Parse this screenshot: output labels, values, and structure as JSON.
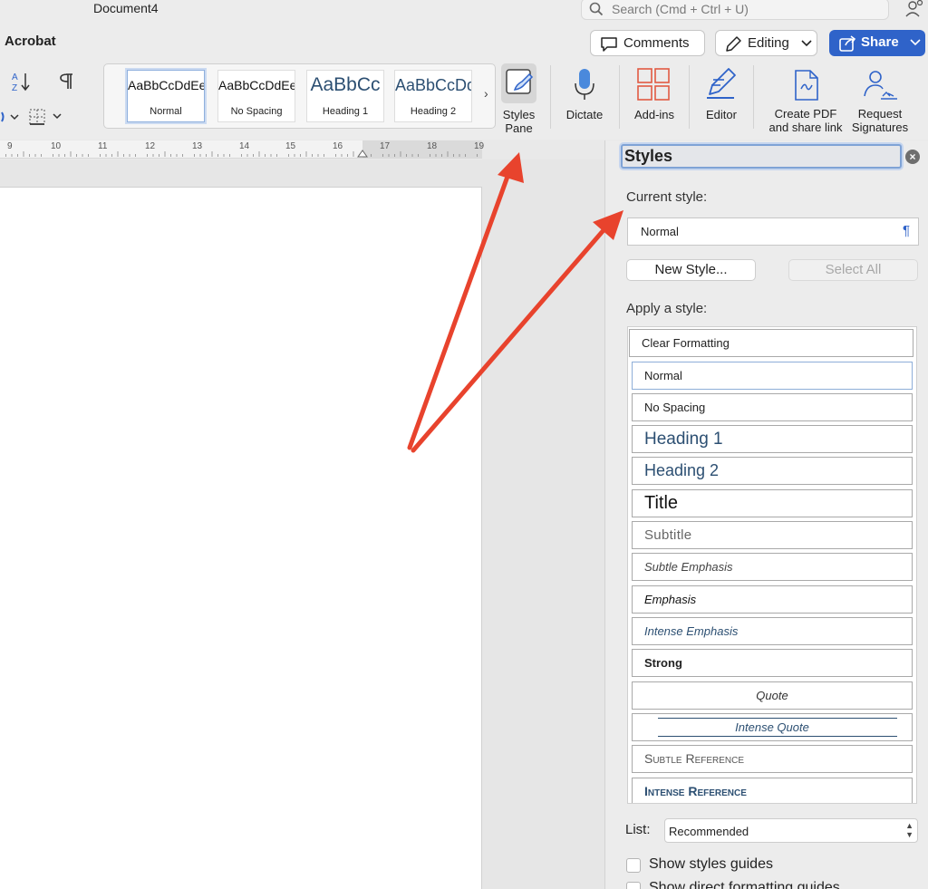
{
  "app": {
    "document_title": "Document4"
  },
  "search": {
    "placeholder": "Search (Cmd + Ctrl + U)"
  },
  "tabs": {
    "active_label": "Acrobat"
  },
  "header_buttons": {
    "comments": "Comments",
    "editing": "Editing",
    "share": "Share"
  },
  "ribbon": {
    "style_tiles": [
      {
        "preview": "AaBbCcDdEe",
        "name": "Normal"
      },
      {
        "preview": "AaBbCcDdEe",
        "name": "No Spacing"
      },
      {
        "preview": "AaBbCc",
        "name": "Heading 1"
      },
      {
        "preview": "AaBbCcDd",
        "name": "Heading 2"
      }
    ],
    "gallery_more": "›",
    "buttons": {
      "styles_pane": [
        "Styles",
        "Pane"
      ],
      "dictate": [
        "Dictate"
      ],
      "add_ins": [
        "Add-ins"
      ],
      "editor": [
        "Editor"
      ],
      "create_pdf": [
        "Create PDF",
        "and share link"
      ],
      "request_signatures": [
        "Request",
        "Signatures"
      ]
    }
  },
  "ruler": {
    "numbers": [
      "9",
      "10",
      "11",
      "12",
      "13",
      "14",
      "15",
      "16",
      "17",
      "18",
      "19"
    ]
  },
  "styles_pane": {
    "title": "Styles",
    "close_glyph": "×",
    "current_style_label": "Current style:",
    "current_style_value": "Normal",
    "pilcrow": "¶",
    "new_style_button": "New Style...",
    "select_all_button": "Select All",
    "apply_label": "Apply a style:",
    "styles": [
      "Clear Formatting",
      "Normal",
      "No Spacing",
      "Heading 1",
      "Heading 2",
      "Title",
      "Subtitle",
      "Subtle Emphasis",
      "Emphasis",
      "Intense Emphasis",
      "Strong",
      "Quote",
      "Intense Quote",
      "Subtle Reference",
      "Intense Reference"
    ],
    "list_label": "List:",
    "list_value": "Recommended",
    "show_styles_guides": "Show styles guides",
    "show_direct_formatting": "Show direct formatting guides"
  },
  "colors": {
    "accent": "#2f63c9",
    "annotation_arrow": "#e8432d",
    "heading_blue": "#2c4f72"
  }
}
